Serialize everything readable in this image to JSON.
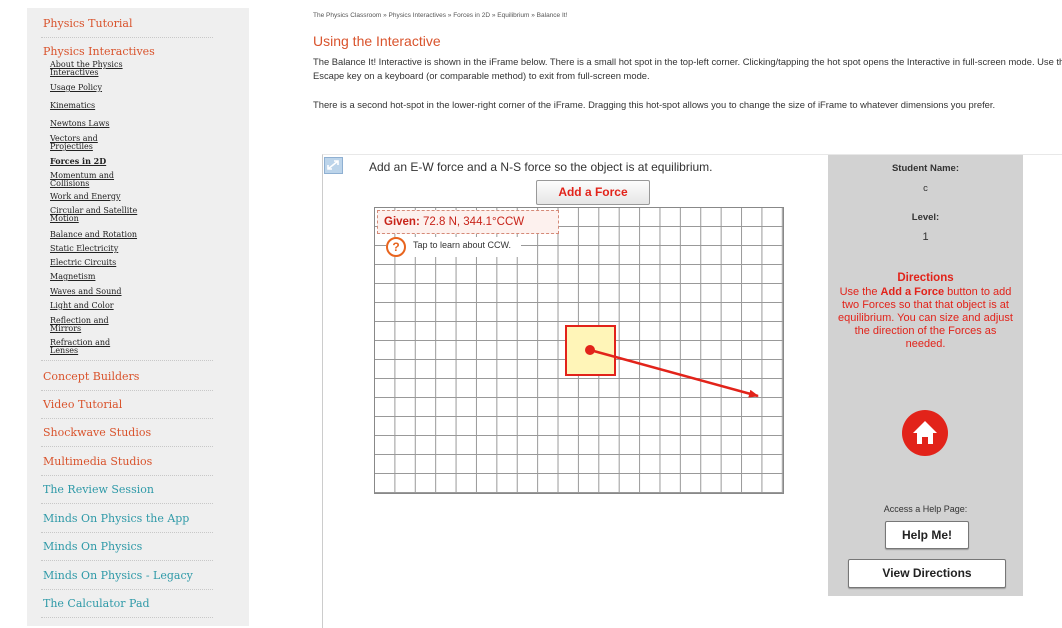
{
  "sidebar": {
    "sections": [
      {
        "label": "Physics Tutorial",
        "color": "orange"
      },
      {
        "label": "Physics Interactives",
        "color": "orange"
      },
      {
        "label": "Concept Builders",
        "color": "orange"
      },
      {
        "label": "Video Tutorial",
        "color": "orange"
      },
      {
        "label": "Shockwave Studios",
        "color": "orange"
      },
      {
        "label": "Multimedia Studios",
        "color": "orange"
      },
      {
        "label": "The Review Session",
        "color": "teal"
      },
      {
        "label": "Minds On Physics the App",
        "color": "teal"
      },
      {
        "label": "Minds On Physics",
        "color": "teal"
      },
      {
        "label": "Minds On Physics - Legacy",
        "color": "teal"
      },
      {
        "label": "The Calculator Pad",
        "color": "teal"
      }
    ],
    "interactives": [
      {
        "label": "About the Physics Interactives"
      },
      {
        "label": "Usage Policy"
      },
      {
        "label": "Kinematics"
      },
      {
        "label": "Newtons Laws"
      },
      {
        "label": "Vectors and Projectiles"
      },
      {
        "label": "Forces in 2D",
        "current": true
      },
      {
        "label": "Momentum and Collisions"
      },
      {
        "label": "Work and Energy"
      },
      {
        "label": "Circular and Satellite Motion"
      },
      {
        "label": "Balance and Rotation"
      },
      {
        "label": "Static Electricity"
      },
      {
        "label": "Electric Circuits"
      },
      {
        "label": "Magnetism"
      },
      {
        "label": "Waves and Sound"
      },
      {
        "label": "Light and Color"
      },
      {
        "label": "Reflection and Mirrors"
      },
      {
        "label": "Refraction and Lenses"
      }
    ]
  },
  "breadcrumb": {
    "items": [
      "The Physics Classroom",
      "Physics Interactives",
      "Forces in 2D",
      "Equilibrium"
    ],
    "separator": " » ",
    "current": "Balance It!"
  },
  "page": {
    "heading": "Using the Interactive",
    "paragraph1": "The Balance It! Interactive is shown in the iFrame below. There is a small hot spot in the top-left corner. Clicking/tapping the hot spot opens the Interactive in full-screen mode. Use the Escape key on a keyboard (or comparable method) to exit from full-screen mode.",
    "paragraph2": "There is a second hot-spot in the lower-right corner of the iFrame. Dragging this hot-spot allows you to change the size of iFrame to whatever dimensions you prefer."
  },
  "interactive": {
    "instruction": "Add an E-W force and a N-S force so the object is at equilibrium.",
    "add_force_label": "Add a Force",
    "given_label": "Given:",
    "given_value": "72.8 N, 344.1°CCW",
    "ccw_help": "Tap to learn about CCW.",
    "ccw_icon": "?",
    "panel": {
      "student_name_label": "Student Name:",
      "student_name_value": "c",
      "level_label": "Level:",
      "level_value": "1",
      "directions_title": "Directions",
      "directions_pre": "Use the ",
      "directions_bold": "Add a Force",
      "directions_post": " button to add two Forces so that that object is at equilibrium. You can size and adjust the direction of the Forces as needed.",
      "help_label": "Access a Help Page:",
      "help_button": "Help Me!",
      "view_directions": "View Directions"
    }
  },
  "colors": {
    "accent_orange": "#d9532c",
    "accent_teal": "#2f9aa8",
    "force_red": "#e2231a",
    "object_fill": "#fff5b8",
    "panel_gray": "#d2d2d2"
  },
  "icons": {
    "fullscreen_hotspot": "fullscreen-hotspot-icon",
    "help": "question-circle-icon",
    "home": "home-icon"
  }
}
